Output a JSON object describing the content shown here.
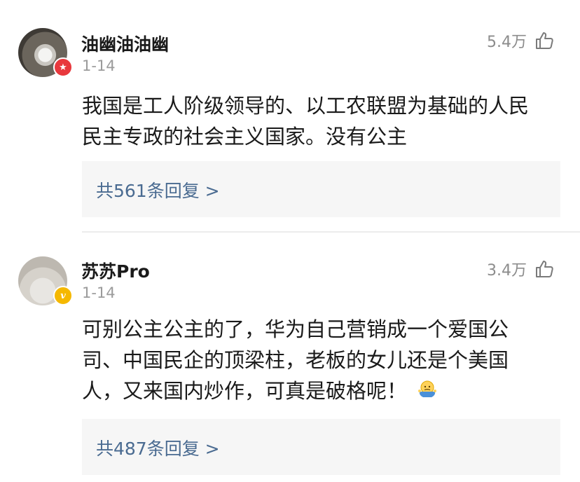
{
  "comments": [
    {
      "username": "油幽油油幽",
      "date": "1-14",
      "likes": "5.4万",
      "content_lines": [
        "我国是工人阶级领导的、以工农联盟为基础的人民",
        "民主专政的社会主义国家。没有公主"
      ],
      "replies": "共561条回复 >",
      "badge": "★",
      "badge_color": "#e8383d"
    },
    {
      "username": "苏苏Pro",
      "date": "1-14",
      "likes": "3.4万",
      "content_lines": [
        "可别公主公主的了，华为自己营销成一个爱国公",
        "司、中国民企的顶梁柱，老板的女儿还是个美国",
        "人，又来国内炒作，可真是破格呢！"
      ],
      "emoji_icon": "shrug-emoji-icon",
      "replies": "共487条回复 >",
      "badge": "v",
      "badge_color": "#f5b800"
    }
  ],
  "colors": {
    "text": "#1a1a1a",
    "muted": "#9b9b9b",
    "link": "#4a6b91",
    "reply_bg": "#f6f6f6"
  }
}
